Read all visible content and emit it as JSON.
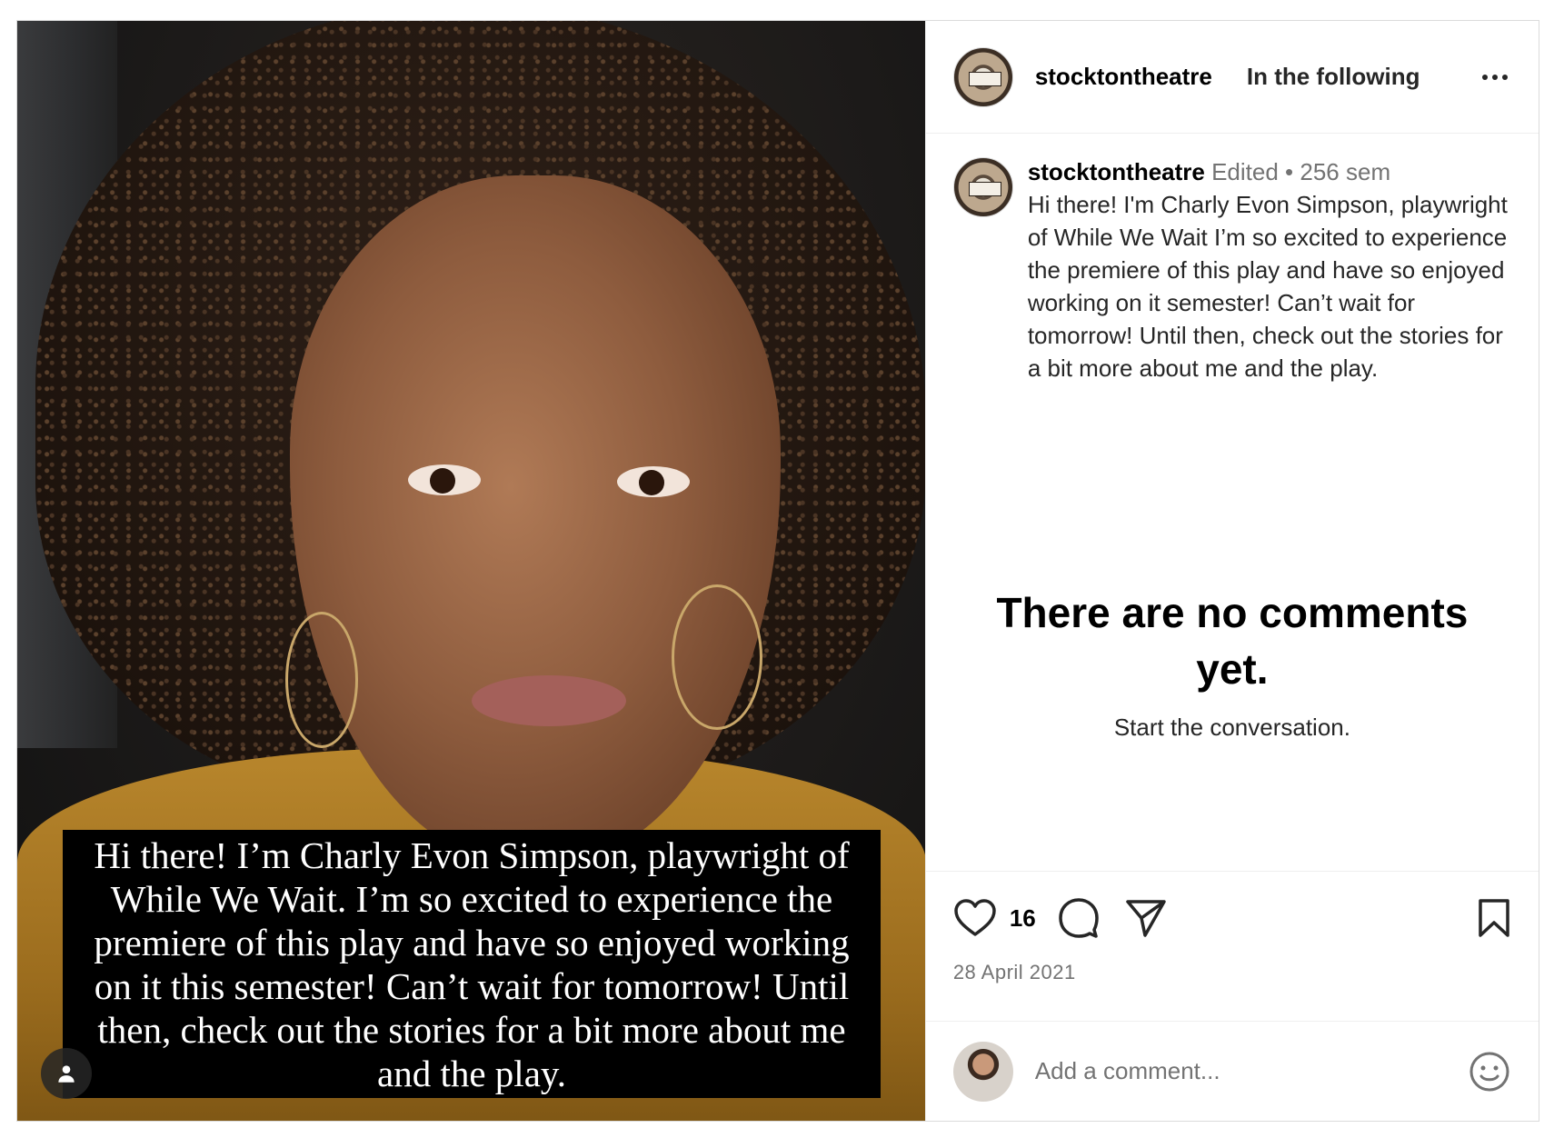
{
  "media": {
    "overlay_caption": "Hi there! I’m Charly Evon Simpson, playwright of While We Wait. I’m so excited to experience the premiere of this play and have so enjoyed working on it this semester! Can’t wait for tomorrow! Until then, check out the stories for a bit more about me and the play.",
    "icons": {
      "user_tag": "user-tag-icon"
    }
  },
  "header": {
    "username": "stocktontheatre",
    "follow_label": "In the following",
    "icons": {
      "avatar": "theatre-logo-avatar",
      "more": "more-options-icon"
    }
  },
  "caption": {
    "username": "stocktontheatre",
    "edited_label": "Edited",
    "separator": " • ",
    "time_ago": "256 sem",
    "text": "Hi there! I'm Charly Evon Simpson, playwright of While We Wait I’m so excited to experience the premiere of this play and have so enjoyed working on it semester! Can’t wait for tomorrow! Until then, check out the stories for a bit more about me and the play."
  },
  "comments": {
    "empty_title": "There are no comments yet.",
    "empty_subtitle": "Start the conversation."
  },
  "actions": {
    "like_count": "16",
    "date": "28 April 2021",
    "icons": {
      "like": "heart-icon",
      "comment": "comment-icon",
      "share": "send-icon",
      "save": "bookmark-icon"
    }
  },
  "comment_box": {
    "placeholder": "Add a comment...",
    "icons": {
      "avatar": "user-avatar",
      "emoji": "emoji-icon"
    }
  },
  "colors": {
    "border": "#dbdbdb",
    "muted_text": "#737373",
    "primary_text": "#262626"
  }
}
